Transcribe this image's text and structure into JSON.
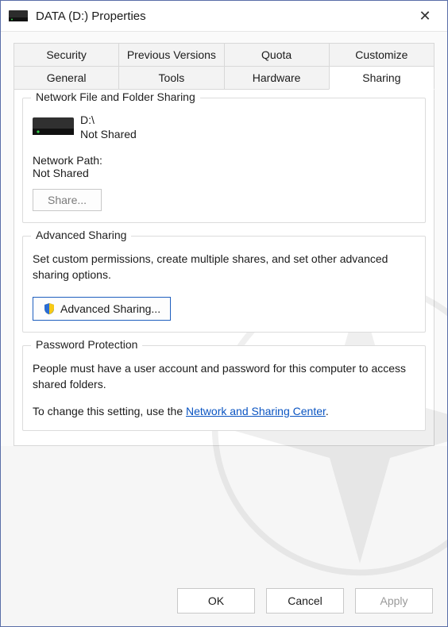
{
  "titlebar": {
    "title": "DATA (D:) Properties"
  },
  "tabs": {
    "row1": [
      "Security",
      "Previous Versions",
      "Quota",
      "Customize"
    ],
    "row2": [
      "General",
      "Tools",
      "Hardware",
      "Sharing"
    ]
  },
  "network_sharing": {
    "legend": "Network File and Folder Sharing",
    "drive_path": "D:\\",
    "drive_status": "Not Shared",
    "network_path_label": "Network Path:",
    "network_path_value": "Not Shared",
    "share_button": "Share..."
  },
  "advanced_sharing": {
    "legend": "Advanced Sharing",
    "description": "Set custom permissions, create multiple shares, and set other advanced sharing options.",
    "button": "Advanced Sharing..."
  },
  "password_protection": {
    "legend": "Password Protection",
    "description": "People must have a user account and password for this computer to access shared folders.",
    "change_prefix": "To change this setting, use the ",
    "change_link": "Network and Sharing Center",
    "change_suffix": "."
  },
  "buttons": {
    "ok": "OK",
    "cancel": "Cancel",
    "apply": "Apply"
  }
}
